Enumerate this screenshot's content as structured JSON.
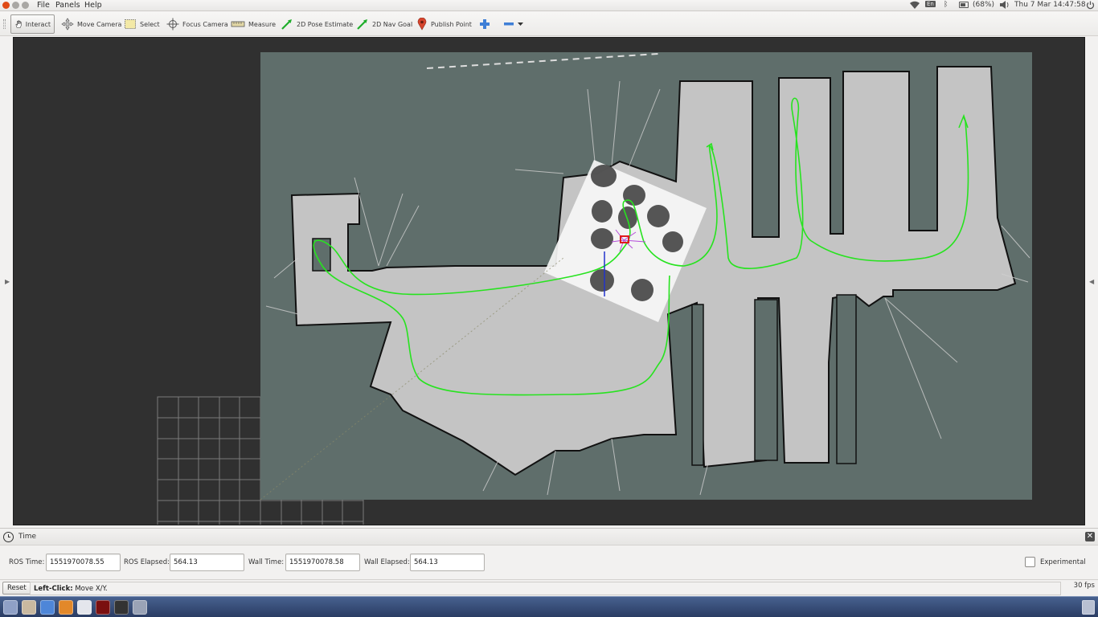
{
  "menubar": {
    "menus": [
      "File",
      "Panels",
      "Help"
    ],
    "keyboard_layout": "En",
    "battery": "(68%)",
    "clock": "Thu 7 Mar 14:47:58"
  },
  "toolbar": {
    "tools": [
      {
        "label": "Interact",
        "icon": "hand-icon",
        "active": true
      },
      {
        "label": "Move Camera",
        "icon": "move-camera-icon",
        "active": false
      },
      {
        "label": "Select",
        "icon": "select-box-icon",
        "active": false
      },
      {
        "label": "Focus Camera",
        "icon": "focus-crosshair-icon",
        "active": false
      },
      {
        "label": "Measure",
        "icon": "ruler-icon",
        "active": false
      },
      {
        "label": "2D Pose Estimate",
        "icon": "green-arrow-icon",
        "active": false
      },
      {
        "label": "2D Nav Goal",
        "icon": "green-arrow-icon",
        "active": false
      },
      {
        "label": "Publish Point",
        "icon": "map-pin-icon",
        "active": false
      }
    ],
    "add_icon": "plus-icon",
    "remove_icon": "minus-icon"
  },
  "viewport": {
    "map_color": "#5f6e6b",
    "free_space_color": "#c4c4c4",
    "path_color": "#27e31f",
    "background": "#303030"
  },
  "time_panel": {
    "title": "Time",
    "ros_time_label": "ROS Time:",
    "ros_time": "1551970078.55",
    "ros_elapsed_label": "ROS Elapsed:",
    "ros_elapsed": "564.13",
    "wall_time_label": "Wall Time:",
    "wall_time": "1551970078.58",
    "wall_elapsed_label": "Wall Elapsed:",
    "wall_elapsed": "564.13",
    "experimental_label": "Experimental"
  },
  "statusbar": {
    "reset_label": "Reset",
    "hint_bold": "Left-Click:",
    "hint_text": " Move X/Y.",
    "fps": "30 fps"
  }
}
